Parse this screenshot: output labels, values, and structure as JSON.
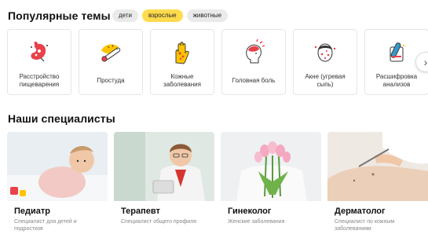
{
  "topics_section": {
    "title": "Популярные темы",
    "chips": [
      {
        "label": "дети",
        "active": false
      },
      {
        "label": "взрослые",
        "active": true
      },
      {
        "label": "животные",
        "active": false
      }
    ],
    "items": [
      {
        "label": "Расстройство пищеварения",
        "icon": "stomach-icon"
      },
      {
        "label": "Простуда",
        "icon": "thermometer-icon"
      },
      {
        "label": "Кожные заболевания",
        "icon": "skin-hand-icon"
      },
      {
        "label": "Головная боль",
        "icon": "headache-icon"
      },
      {
        "label": "Акне (угревая сыпь)",
        "icon": "acne-face-icon"
      },
      {
        "label": "Расшифровка анализов",
        "icon": "test-tube-icon"
      }
    ],
    "next_icon": "chevron-right-icon"
  },
  "specialists_section": {
    "title": "Наши специалисты",
    "items": [
      {
        "name": "Педиатр",
        "desc": "Специалист для детей и подростков",
        "photo": "baby-photo"
      },
      {
        "name": "Терапевт",
        "desc": "Специалист общего профиля",
        "photo": "doctor-photo"
      },
      {
        "name": "Гинеколог",
        "desc": "Женские заболевания",
        "photo": "tulips-photo"
      },
      {
        "name": "Дерматолог",
        "desc": "Специалист по кожным заболеваниям",
        "photo": "skin-check-photo"
      }
    ]
  },
  "colors": {
    "accent": "#ffdb4d",
    "chip": "#eaeaea",
    "icon_red": "#e8414a",
    "icon_yellow": "#ffc400"
  }
}
